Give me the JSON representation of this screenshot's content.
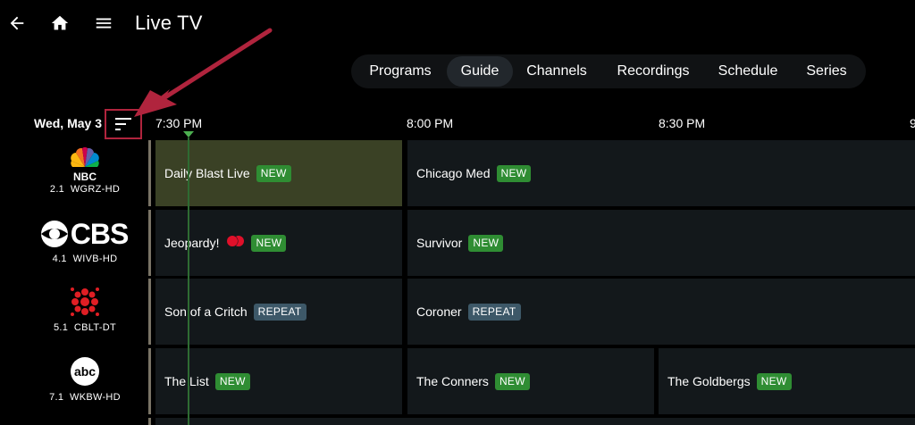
{
  "header": {
    "title": "Live TV",
    "icons": [
      "back-arrow-icon",
      "home-icon",
      "menu-icon"
    ]
  },
  "tabs": [
    {
      "label": "Programs",
      "active": false
    },
    {
      "label": "Guide",
      "active": true
    },
    {
      "label": "Channels",
      "active": false
    },
    {
      "label": "Recordings",
      "active": false
    },
    {
      "label": "Schedule",
      "active": false
    },
    {
      "label": "Series",
      "active": false
    }
  ],
  "timeline": {
    "date": "Wed, May 3",
    "times": [
      "7:30 PM",
      "8:00 PM",
      "8:30 PM",
      "9"
    ]
  },
  "channels": [
    {
      "logo": "NBC",
      "number": "2.1",
      "callsign": "WGRZ-HD",
      "programs": [
        {
          "title": "Daily Blast Live",
          "badge": "NEW"
        },
        {
          "title": "Chicago Med",
          "badge": "NEW"
        }
      ]
    },
    {
      "logo": "CBS",
      "number": "4.1",
      "callsign": "WIVB-HD",
      "programs": [
        {
          "title": "Jeopardy!",
          "badge": "NEW",
          "recording": true
        },
        {
          "title": "Survivor",
          "badge": "NEW"
        }
      ]
    },
    {
      "logo": "CBC",
      "number": "5.1",
      "callsign": "CBLT-DT",
      "programs": [
        {
          "title": "Son of a Critch",
          "badge": "REPEAT"
        },
        {
          "title": "Coroner",
          "badge": "REPEAT"
        }
      ]
    },
    {
      "logo": "abc",
      "number": "7.1",
      "callsign": "WKBW-HD",
      "programs": [
        {
          "title": "The List",
          "badge": "NEW"
        },
        {
          "title": "The Conners",
          "badge": "NEW"
        },
        {
          "title": "The Goldbergs",
          "badge": "NEW"
        }
      ]
    }
  ],
  "colors": {
    "badge_new": "#2f8d33",
    "badge_repeat": "#3d5868",
    "highlight_cell": "#3a4125",
    "now_marker": "#4caf50",
    "annotation": "#b0243d"
  }
}
